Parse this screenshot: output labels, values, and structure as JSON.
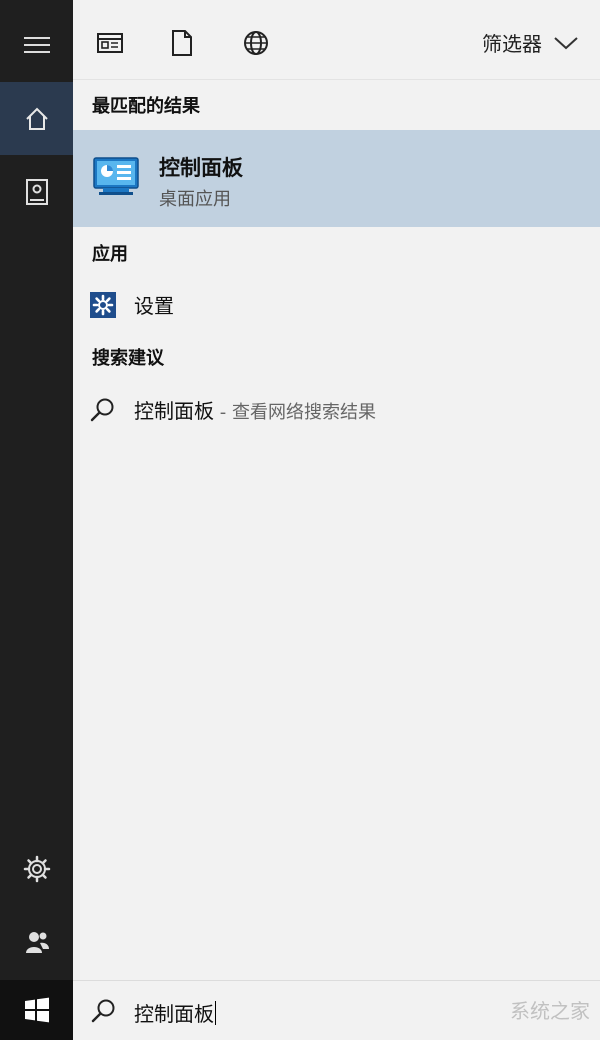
{
  "toolbar": {
    "filter_label": "筛选器"
  },
  "sections": {
    "best_match": "最匹配的结果",
    "apps": "应用",
    "suggestions": "搜索建议"
  },
  "best_match": {
    "title": "控制面板",
    "subtitle": "桌面应用"
  },
  "apps": [
    {
      "label": "设置"
    }
  ],
  "suggestions": [
    {
      "query": "控制面板",
      "hint": " - 查看网络搜索结果"
    }
  ],
  "search": {
    "value": "控制面板"
  },
  "watermark": "系统之家",
  "colors": {
    "rail_bg": "#1f1f1f",
    "rail_active": "#2b3a4f",
    "selection": "#c1d1e0",
    "panel_bg": "#f2f2f2"
  }
}
